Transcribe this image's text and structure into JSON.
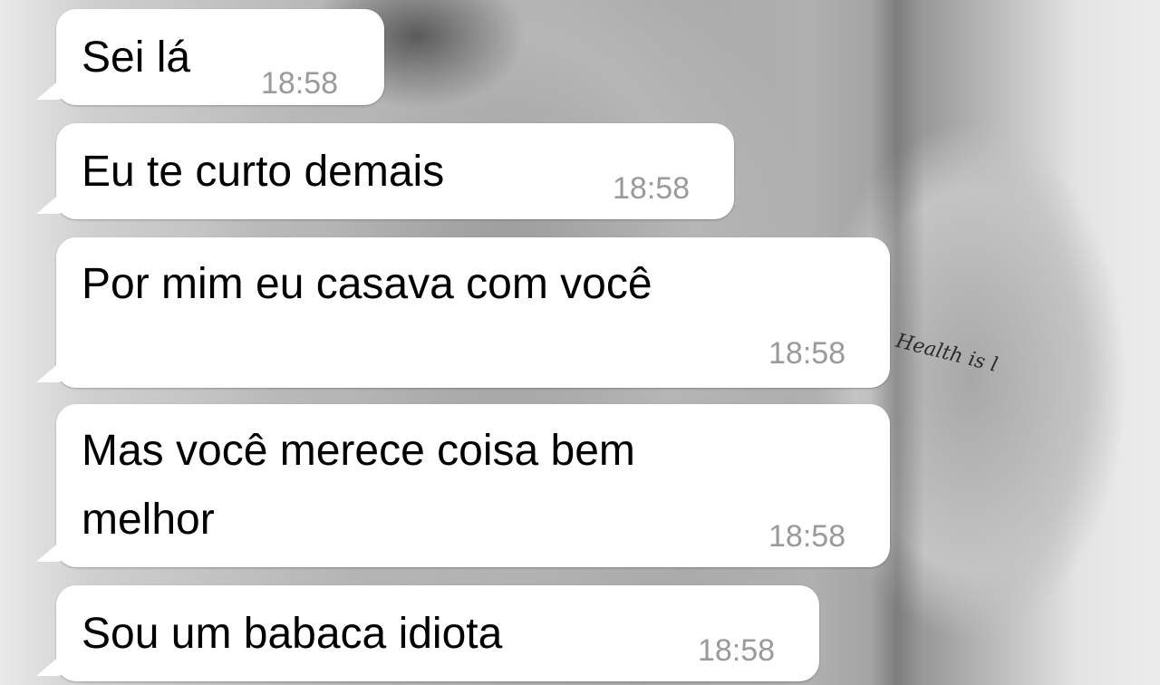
{
  "chat": {
    "messages": [
      {
        "text": "Sei lá",
        "time": "18:58"
      },
      {
        "text": "Eu te curto demais",
        "time": "18:58"
      },
      {
        "text": "Por mim eu casava com você",
        "time": "18:58"
      },
      {
        "lines": [
          "Mas você merece coisa bem",
          "melhor"
        ],
        "time": "18:58"
      },
      {
        "text": "Sou um babaca idiota",
        "time": "18:58"
      }
    ]
  },
  "wallpaper": {
    "tattoo_text": "Health is l"
  }
}
